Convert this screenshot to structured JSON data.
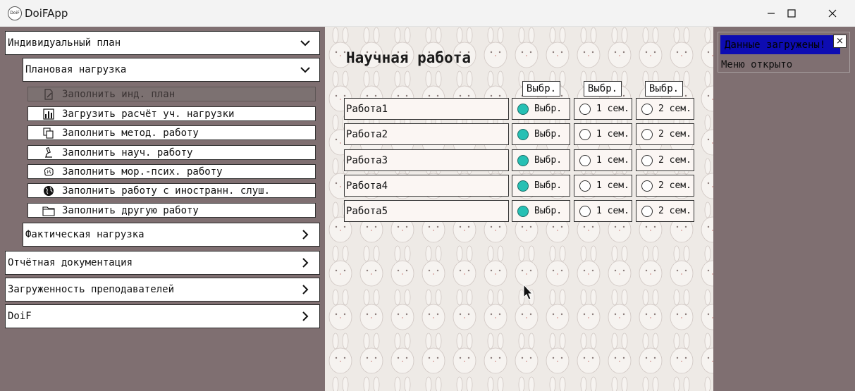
{
  "window": {
    "title": "DoiFApp",
    "icon_text": "DoiF",
    "icon_name": "app-logo-icon"
  },
  "menu": {
    "individual_plan": "Индивидуальный план",
    "planned_load": "Плановая нагрузка",
    "sub_items": [
      {
        "label": "Заполнить инд. план",
        "icon": "edit-document-icon",
        "active": true
      },
      {
        "label": "Загрузить расчёт уч. нагрузки",
        "icon": "bar-chart-icon",
        "active": false
      },
      {
        "label": "Заполнить метод. работу",
        "icon": "copy-pages-icon",
        "active": false
      },
      {
        "label": "Заполнить науч. работу",
        "icon": "microscope-icon",
        "active": false
      },
      {
        "label": "Заполнить мор.-псих. работу",
        "icon": "brain-icon",
        "active": false
      },
      {
        "label": "Заполнить работу с иностранн. слуш.",
        "icon": "globe-icon",
        "active": false
      },
      {
        "label": "Заполнить другую работу",
        "icon": "folder-icon",
        "active": false
      }
    ],
    "actual_load": "Фактическая нагрузка",
    "report_docs": "Отчётная документация",
    "teacher_load": "Загруженность преподавателей",
    "doif": "DoiF"
  },
  "main": {
    "title": "Научная работа",
    "column_buttons": [
      "Выбр.",
      "Выбр.",
      "Выбр."
    ],
    "rows": [
      {
        "name": "Работа1",
        "options": [
          "Выбр.",
          "1 сем.",
          "2 сем."
        ],
        "selected": 0
      },
      {
        "name": "Работа2",
        "options": [
          "Выбр.",
          "1 сем.",
          "2 сем."
        ],
        "selected": 0
      },
      {
        "name": "Работа3",
        "options": [
          "Выбр.",
          "1 сем.",
          "2 сем."
        ],
        "selected": 0
      },
      {
        "name": "Работа4",
        "options": [
          "Выбр.",
          "1 сем.",
          "2 сем."
        ],
        "selected": 0
      },
      {
        "name": "Работа5",
        "options": [
          "Выбр.",
          "1 сем.",
          "2 сем."
        ],
        "selected": 0
      }
    ]
  },
  "notification": {
    "message": "Данные загружены!",
    "close_label": "×",
    "status": "Меню открыто"
  },
  "colors": {
    "panel_bg": "#7f6f71",
    "radio_checked": "#26c0b4",
    "notification_bar": "#0d0cb2"
  }
}
